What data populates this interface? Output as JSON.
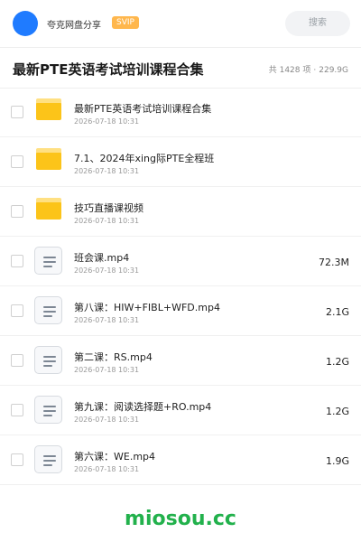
{
  "header": {
    "username": "夸克网盘分享",
    "badge": "SVIP",
    "search_placeholder": "搜索"
  },
  "title": {
    "text": "最新PTE英语考试培训课程合集",
    "count": "共 1428 项",
    "separator": "·",
    "size": "229.9G"
  },
  "files": [
    {
      "type": "folder",
      "name": "最新PTE英语考试培训课程合集",
      "date": "2026-07-18 10:31",
      "size": ""
    },
    {
      "type": "folder",
      "name": "7.1、2024年xing际PTE全程班",
      "date": "2026-07-18 10:31",
      "size": ""
    },
    {
      "type": "folder",
      "name": "技巧直播课视频",
      "date": "2026-07-18 10:31",
      "size": ""
    },
    {
      "type": "file",
      "name": "班会课.mp4",
      "date": "2026-07-18 10:31",
      "size": "72.3M"
    },
    {
      "type": "file",
      "name": "第八课：HIW+FIBL+WFD.mp4",
      "date": "2026-07-18 10:31",
      "size": "2.1G"
    },
    {
      "type": "file",
      "name": "第二课：RS.mp4",
      "date": "2026-07-18 10:31",
      "size": "1.2G"
    },
    {
      "type": "file",
      "name": "第九课：阅读选择题+RO.mp4",
      "date": "2026-07-18 10:31",
      "size": "1.2G"
    },
    {
      "type": "file",
      "name": "第六课：WE.mp4",
      "date": "2026-07-18 10:31",
      "size": "1.9G"
    }
  ],
  "watermark": "miosou.cc",
  "colors": {
    "avatar": "#1f7bff",
    "svip": "#ffb74d",
    "folder": "#fcc419",
    "watermark": "#22b14c"
  }
}
